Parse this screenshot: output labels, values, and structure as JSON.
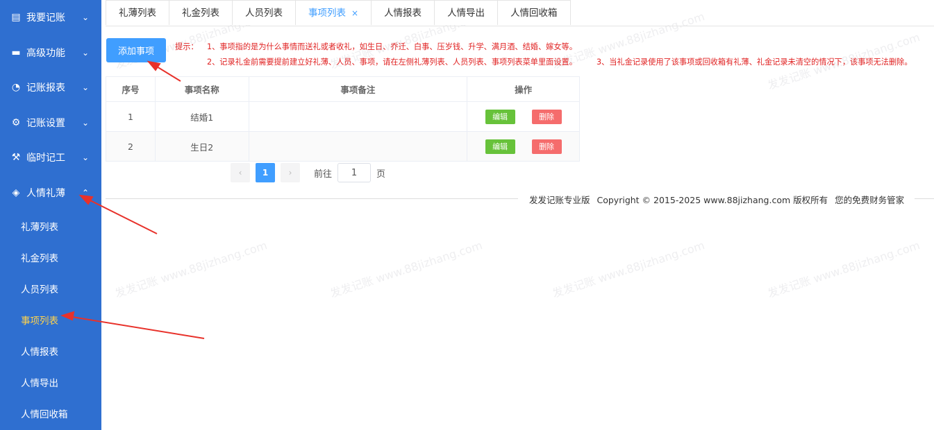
{
  "sidebar": {
    "groups": [
      {
        "label": "我要记账",
        "icon": "ledger-icon",
        "glyph": "▤",
        "chevron": "⌄"
      },
      {
        "label": "高级功能",
        "icon": "briefcase-icon",
        "glyph": "▬",
        "chevron": "⌄"
      },
      {
        "label": "记账报表",
        "icon": "pie-chart-icon",
        "glyph": "◔",
        "chevron": "⌄"
      },
      {
        "label": "记账设置",
        "icon": "gear-icon",
        "glyph": "⚙",
        "chevron": "⌄"
      },
      {
        "label": "临时记工",
        "icon": "tools-icon",
        "glyph": "⚒",
        "chevron": "⌄"
      },
      {
        "label": "人情礼薄",
        "icon": "gem-icon",
        "glyph": "◈",
        "chevron": "⌃"
      }
    ],
    "subitems": [
      {
        "label": "礼薄列表"
      },
      {
        "label": "礼金列表"
      },
      {
        "label": "人员列表"
      },
      {
        "label": "事项列表",
        "active": true
      },
      {
        "label": "人情报表"
      },
      {
        "label": "人情导出"
      },
      {
        "label": "人情回收箱"
      }
    ]
  },
  "tabs": [
    {
      "label": "礼薄列表"
    },
    {
      "label": "礼金列表"
    },
    {
      "label": "人员列表"
    },
    {
      "label": "事项列表",
      "active": true,
      "close": "×"
    },
    {
      "label": "人情报表"
    },
    {
      "label": "人情导出"
    },
    {
      "label": "人情回收箱"
    }
  ],
  "toolbar": {
    "add_label": "添加事项"
  },
  "tips": {
    "prefix": "提示：",
    "line1": "1、事项指的是为什么事情而送礼或者收礼，如生日、乔迁、白事、压岁钱、升学、满月酒、结婚、嫁女等。",
    "line2a": "2、记录礼金前需要提前建立好礼薄、人员、事项，请在左侧礼薄列表、人员列表、事项列表菜单里面设置。",
    "line2b": "3、当礼金记录使用了该事项或回收箱有礼薄、礼金记录未清空的情况下，该事项无法删除。"
  },
  "table": {
    "headers": [
      "序号",
      "事项名称",
      "事项备注",
      "操作"
    ],
    "rows": [
      {
        "index": "1",
        "name": "结婚1",
        "note": "",
        "edit": "编辑",
        "delete": "删除"
      },
      {
        "index": "2",
        "name": "生日2",
        "note": "",
        "edit": "编辑",
        "delete": "删除"
      }
    ]
  },
  "pagination": {
    "prev": "‹",
    "next": "›",
    "current": "1",
    "goto_label": "前往",
    "goto_value": "1",
    "unit": "页"
  },
  "footer": {
    "product": "发发记账专业版",
    "copyright": "Copyright © 2015-2025 www.88jizhang.com 版权所有",
    "slogan": "您的免费财务管家"
  },
  "watermark": "发发记账 www.88jizhang.com",
  "colors": {
    "sidebar": "#2f6fd0",
    "accent": "#409eff",
    "active_sub": "#ffd34d",
    "tip": "#e02222",
    "edit": "#67c23a",
    "delete": "#f56c6c",
    "arrow": "#e8312a"
  }
}
